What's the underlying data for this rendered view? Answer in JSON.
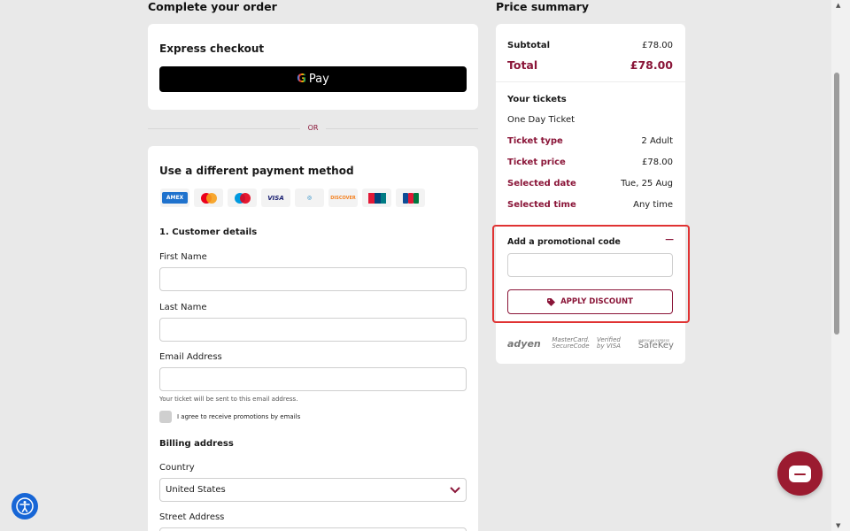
{
  "left": {
    "heading": "Complete your order",
    "express": {
      "title": "Express checkout",
      "gpay_g": "G",
      "gpay_label": "Pay"
    },
    "or_label": "OR",
    "payment": {
      "title": "Use a different payment method",
      "cards": [
        "AMEX",
        "MC",
        "MAESTRO",
        "VISA",
        "DINERS",
        "DISCOVER",
        "UNIONPAY",
        "JCB"
      ],
      "customer_heading": "1. Customer details",
      "first_name_label": "First Name",
      "first_name_value": "",
      "last_name_label": "Last Name",
      "last_name_value": "",
      "email_label": "Email Address",
      "email_value": "",
      "email_hint": "Your ticket will be sent to this email address.",
      "promo_opt_in": "I agree to receive promotions by emails",
      "billing_heading": "Billing address",
      "country_label": "Country",
      "country_value": "United States",
      "street_label": "Street Address"
    }
  },
  "right": {
    "heading": "Price summary",
    "subtotal_label": "Subtotal",
    "subtotal_value": "£78.00",
    "total_label": "Total",
    "total_value": "£78.00",
    "tickets_heading": "Your tickets",
    "ticket_name": "One Day Ticket",
    "rows": [
      {
        "label": "Ticket type",
        "value": "2 Adult"
      },
      {
        "label": "Ticket price",
        "value": "£78.00"
      },
      {
        "label": "Selected date",
        "value": "Tue, 25 Aug"
      },
      {
        "label": "Selected time",
        "value": "Any time"
      }
    ],
    "promo": {
      "title": "Add a promotional code",
      "toggle": "−",
      "input_value": "",
      "apply_label": "APPLY DISCOUNT"
    },
    "secure_logos": [
      "adyen",
      "MasterCard. SecureCode",
      "Verified by VISA",
      "AMERICAN EXPRESS",
      "SafeKey"
    ]
  },
  "colors": {
    "accent": "#8a1538",
    "highlight_border": "#e03333",
    "accessibility": "#1766d6",
    "chat": "#9b1b30"
  },
  "icons": {
    "accessibility": "accessibility-icon",
    "chat": "chat-icon",
    "tag": "tag-icon",
    "chevron": "chevron-down-icon"
  }
}
